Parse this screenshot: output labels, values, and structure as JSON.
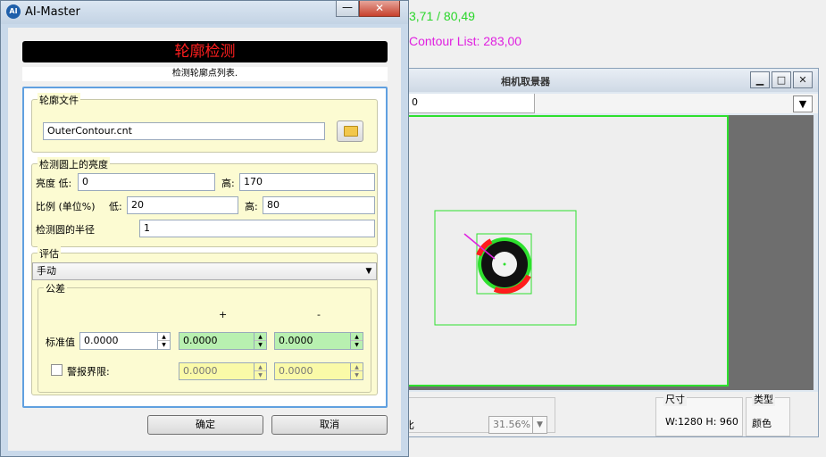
{
  "background": {
    "coord_text": "3,71 / 80,49",
    "contour_text": "Contour List: 283,00",
    "coord_color": "#2ad62a",
    "contour_color": "#e020e0"
  },
  "camera_window": {
    "title": "相机取景器",
    "min_icon": "minimize-icon",
    "max_icon": "maximize-icon",
    "close_icon": "close-icon",
    "tab_value": "0",
    "combo_arrow": "▼",
    "zoom_label": "比",
    "zoom_value": "31.56%",
    "size_title": "尺寸",
    "size_value": "W:1280  H: 960",
    "type_title": "类型",
    "type_value": "颜色"
  },
  "dialog": {
    "title": "AI-Master",
    "logo_text": "AI",
    "minimize_glyph": "—",
    "close_glyph": "✕",
    "banner": "轮廓检测",
    "banner_color": "#ff1e1e",
    "subtitle": "检测轮廓点列表.",
    "file_group": {
      "title": "轮廓文件",
      "value": "OuterContour.cnt",
      "browse_icon": "folder-icon"
    },
    "brightness_group": {
      "title": "检测圆上的亮度",
      "brightness_low_label": "亮度 低:",
      "brightness_low": "0",
      "brightness_high_label": "高:",
      "brightness_high": "170",
      "ratio_label": "比例 (单位%)",
      "ratio_low_label": "低:",
      "ratio_low": "20",
      "ratio_high_label": "高:",
      "ratio_high": "80",
      "radius_label": "检测圆的半径",
      "radius": "1"
    },
    "eval_group": {
      "title": "评估",
      "mode": "手动",
      "tolerance": {
        "title": "公差",
        "plus_label": "+",
        "minus_label": "-",
        "standard_label": "标准值",
        "standard_value": "0.0000",
        "plus_value": "0.0000",
        "minus_value": "0.0000",
        "warn_label": "警报界限:",
        "warn_plus": "0.0000",
        "warn_minus": "0.0000",
        "warn_checked": false
      }
    },
    "ok_label": "确定",
    "cancel_label": "取消"
  }
}
